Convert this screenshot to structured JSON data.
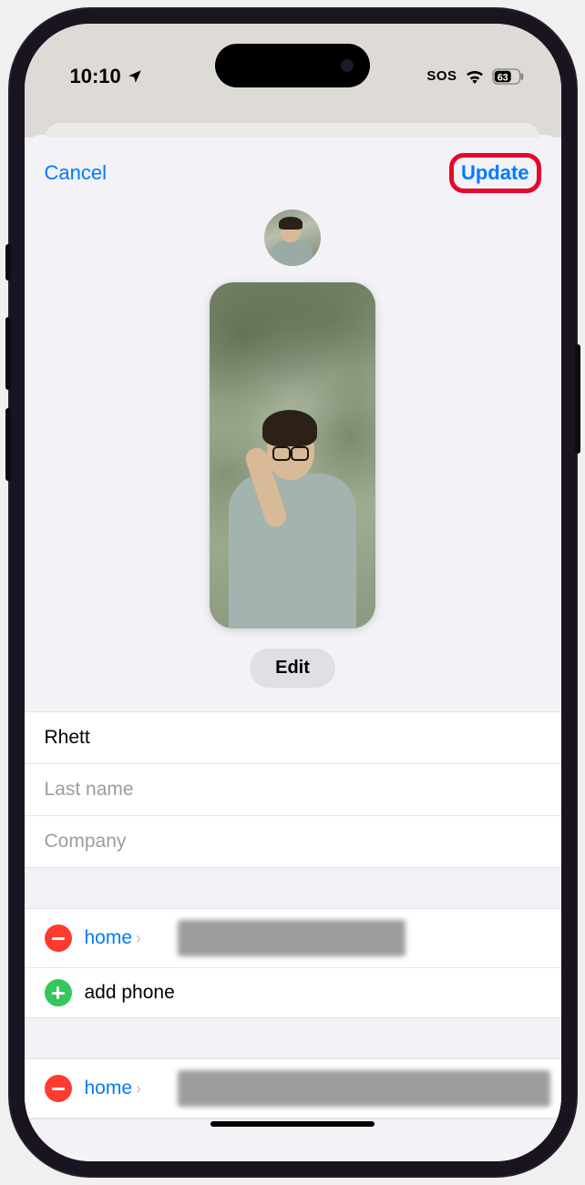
{
  "status": {
    "time": "10:10",
    "sos": "SOS",
    "battery": "63"
  },
  "header": {
    "cancel": "Cancel",
    "update": "Update"
  },
  "poster": {
    "edit": "Edit"
  },
  "fields": {
    "first_name": "Rhett",
    "last_name_placeholder": "Last name",
    "company_placeholder": "Company"
  },
  "phones": {
    "row1_label": "home",
    "add_label": "add phone",
    "row2_label": "home"
  }
}
